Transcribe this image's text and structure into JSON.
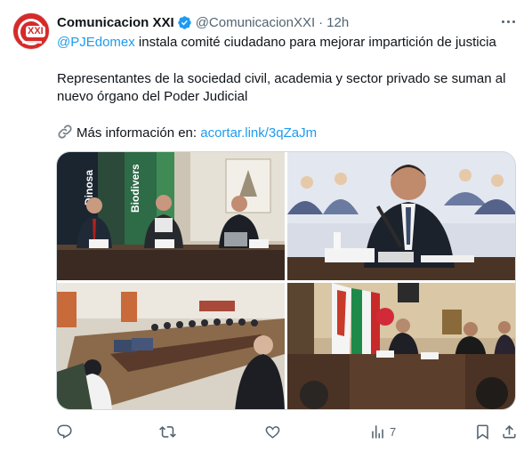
{
  "author": {
    "name": "Comunicacion XXI",
    "handle": "@ComunicacionXXI",
    "separator": "·",
    "time": "12h",
    "avatar_monogram": "XXI"
  },
  "tweet": {
    "mention": "@PJEdomex",
    "line1_rest": " instala comité ciudadano para mejorar impartición de justicia",
    "line2": "Representantes de la sociedad civil, academia y sector privado se suman al",
    "line3": "nuevo órgano del Poder Judicial",
    "more_info_label": "Más información en: ",
    "link": "acortar.link/3qZaJm"
  },
  "photo1": {
    "banner_left": "Dinosa",
    "banner_right": "Biodivers"
  },
  "stats": {
    "views": "7"
  },
  "icons": {
    "verified": "verified-badge-icon",
    "more": "more-options-icon",
    "reply": "reply-icon",
    "retweet": "retweet-icon",
    "like": "like-icon",
    "views": "views-icon",
    "bookmark": "bookmark-icon",
    "share": "share-icon",
    "link": "link-chain-icon"
  },
  "colors": {
    "accent": "#1d9bf0",
    "secondary_text": "#536471",
    "avatar_red": "#d62a2a"
  }
}
